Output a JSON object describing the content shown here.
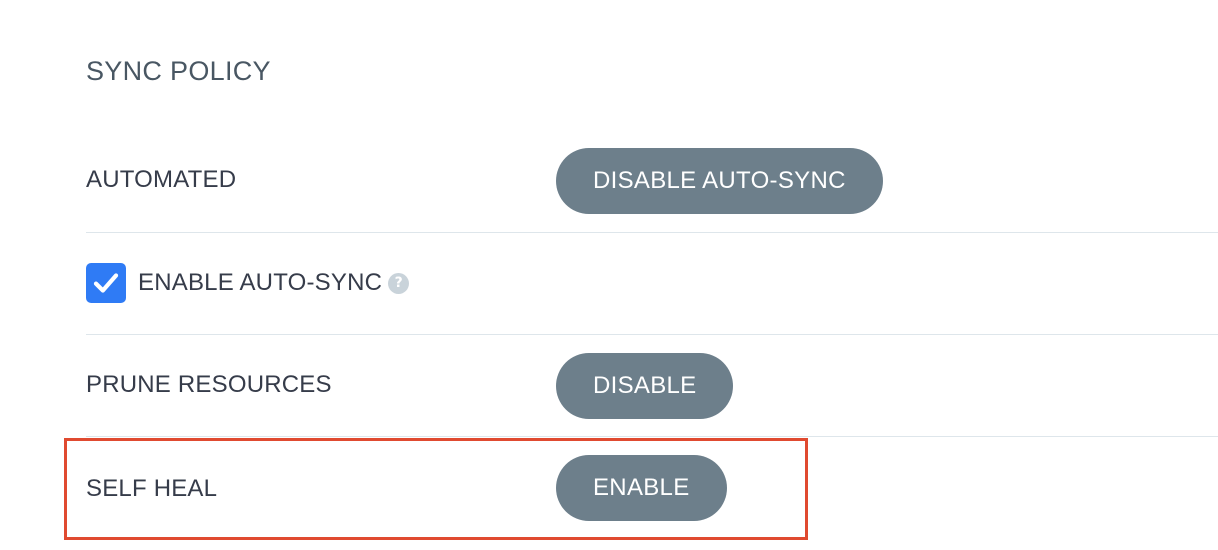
{
  "sync_policy": {
    "title": "SYNC POLICY",
    "automated": {
      "label": "AUTOMATED",
      "button_label": "DISABLE AUTO-SYNC"
    },
    "enable_auto_sync": {
      "label": "ENABLE AUTO-SYNC",
      "checked": true,
      "help_glyph": "?",
      "icon": "help-icon"
    },
    "prune_resources": {
      "label": "PRUNE RESOURCES",
      "button_label": "DISABLE"
    },
    "self_heal": {
      "label": "SELF HEAL",
      "button_label": "ENABLE"
    }
  },
  "colors": {
    "button_bg": "#6d7f8b",
    "checkbox_bg": "#2f7bf5",
    "highlight_border": "#e04a30",
    "divider": "#dee6eb"
  }
}
